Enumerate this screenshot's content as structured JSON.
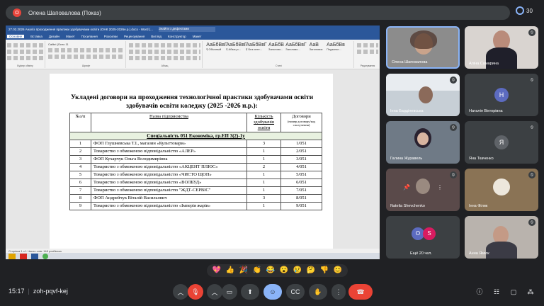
{
  "meeting": {
    "presenter_initial": "O",
    "presenter_label": "Олена Шаповалова (Показ)",
    "people_count": "30",
    "meeting_code": "zoh-pqvf-kej",
    "time": "15:17"
  },
  "word": {
    "title": "27.02.2026 Аналіз проходження практики здобувачами освіти (ОНК 2025-2026н.р.).docx - Word (...",
    "search": "Знайти з дефектами",
    "tabs": [
      "Основне",
      "Вставка",
      "Дизайн",
      "Макет",
      "Посилання",
      "Розсилки",
      "Рецензування",
      "Вигляд",
      "Конструктор",
      "Макет"
    ],
    "ribbon_groups": [
      "Буфер обміну",
      "Шрифт",
      "Абзац",
      "Стилі",
      "Редагування"
    ],
    "styles": [
      {
        "sample": "АаБбВвГ",
        "name": "¶ Обычный"
      },
      {
        "sample": "АаБбВвГ",
        "name": "¶ Абзац с..."
      },
      {
        "sample": "АаБбВвГ",
        "name": "¶ Без инте..."
      },
      {
        "sample": "АаБбВ",
        "name": "Заголово..."
      },
      {
        "sample": "АаБбВвГ",
        "name": "Заголово..."
      },
      {
        "sample": "АаВ",
        "name": "Заголовок"
      },
      {
        "sample": "АаБбВв",
        "name": "Подзагол..."
      }
    ],
    "status": "Сторінка 1 з 1    Число слів: 148    російська",
    "font": "Calibri (Осно",
    "size": "11"
  },
  "document": {
    "title": "Укладені договори на проходження технологічної практики здобувачами освіти здобувачів освіти коледжу (2025 -2026 н.р.):",
    "headers": {
      "num": "№з/п",
      "name": "Назва підприємства",
      "count": "Кількість здобувачів освіти",
      "contract": "Договори",
      "contract_sub": "(номер договору/код сполучення)"
    },
    "specialty": "Спеціальність 051 Економіка, гр.ЕП 3(2)-1у",
    "rows": [
      {
        "n": "1",
        "name": "ФОП Глушневська Т.І., магазин «Культтовари»",
        "count": "3",
        "contract": "1/051"
      },
      {
        "n": "2",
        "name": "Товариство з обмеженою відповідальністю «АЛЕР»",
        "count": "1",
        "contract": "2/051"
      },
      {
        "n": "3",
        "name": "ФОП Кухарчук Ольга Володимирівна",
        "count": "1",
        "contract": "3/051"
      },
      {
        "n": "4",
        "name": "Товариство з обмеженою відповідальністю «АКЦЕНТ ПЛЮС»",
        "count": "2",
        "contract": "4/051"
      },
      {
        "n": "5",
        "name": "Товариство з обмеженою відповідальністю «ЧИСТО ЩОП»",
        "count": "1",
        "contract": "5/051"
      },
      {
        "n": "6",
        "name": "Товариство з обмеженою відповідальністю «ВОЛБУД»",
        "count": "1",
        "contract": "6/051"
      },
      {
        "n": "7",
        "name": "Товариство з обмеженою відповідальністю \"ЖДТ-СЕРВІС\"",
        "count": "1",
        "contract": "7/051"
      },
      {
        "n": "8",
        "name": "ФОП Андрейчук Віталій Васильович",
        "count": "3",
        "contract": "8/051"
      },
      {
        "n": "9",
        "name": "Товариство з обмеженою відповідальністю «Імперія жарів»",
        "count": "1",
        "contract": "9/051"
      }
    ]
  },
  "participants": [
    {
      "name": "Олена Шаповалова",
      "initial": "",
      "muted": false
    },
    {
      "name": "Аліна Самарина",
      "initial": "",
      "muted": true
    },
    {
      "name": "Інна Барділевська",
      "initial": "",
      "muted": true
    },
    {
      "name": "Наталія Вікторівна",
      "initial": "Н",
      "muted": true
    },
    {
      "name": "Галина Журавель",
      "initial": "",
      "muted": true
    },
    {
      "name": "Яна Ткаченко",
      "initial": "Я",
      "muted": true
    },
    {
      "name": "Natelia Shevchenko",
      "initial": "",
      "muted": true
    },
    {
      "name": "Інна Філик",
      "initial": "",
      "muted": true
    },
    {
      "name": "Ещё 20 чел.",
      "initial": "",
      "muted": false
    },
    {
      "name": "Анна Ямюк",
      "initial": "",
      "muted": true
    }
  ],
  "others_initials": [
    "O",
    "S"
  ],
  "reactions": [
    "💖",
    "👍",
    "🎉",
    "👏",
    "😂",
    "😮",
    "😢",
    "🤔",
    "👎",
    "😊"
  ],
  "colors": {
    "accent": "#8ab4f8",
    "danger": "#ea4335",
    "word_blue": "#2b579a"
  }
}
